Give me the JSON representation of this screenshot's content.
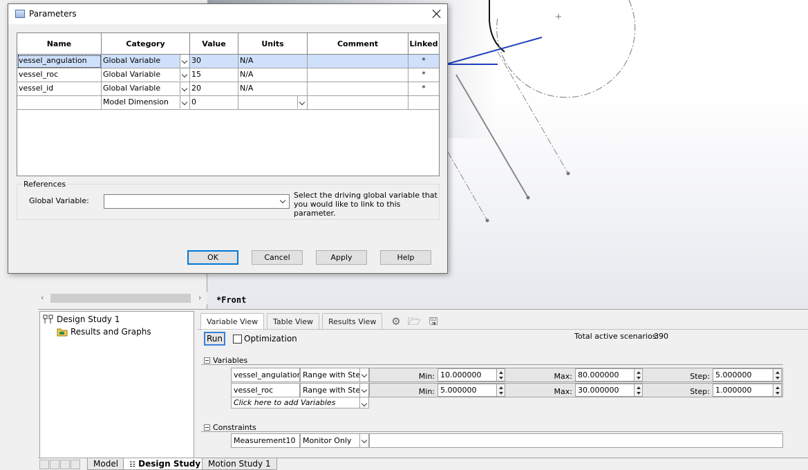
{
  "dialog": {
    "title": "Parameters",
    "columns": [
      "Name",
      "Category",
      "Value",
      "Units",
      "Comment",
      "Linked"
    ],
    "rows": [
      {
        "name": "vessel_angulation",
        "category": "Global Variable",
        "value": "30",
        "units": "N/A",
        "comment": "",
        "linked": "*"
      },
      {
        "name": "vessel_roc",
        "category": "Global Variable",
        "value": "15",
        "units": "N/A",
        "comment": "",
        "linked": "*"
      },
      {
        "name": "vessel_id",
        "category": "Global Variable",
        "value": "20",
        "units": "N/A",
        "comment": "",
        "linked": "*"
      },
      {
        "name": "",
        "category": "Model Dimension",
        "value": "0",
        "units": "",
        "comment": "",
        "linked": ""
      }
    ],
    "references": {
      "group_label": "References",
      "global_variable_label": "Global Variable:",
      "global_variable_value": "",
      "help_text": "Select the driving global variable that you would like to link to this parameter."
    },
    "buttons": {
      "ok": "OK",
      "cancel": "Cancel",
      "apply": "Apply",
      "help": "Help"
    }
  },
  "viewport": {
    "view_label": "*Front"
  },
  "study": {
    "tree": {
      "root": "Design Study 1",
      "child": "Results and Graphs"
    },
    "tabs": [
      "Variable View",
      "Table View",
      "Results View"
    ],
    "run_label": "Run",
    "optimization_label": "Optimization",
    "total_scenarios_label": "Total active scenarios:",
    "total_scenarios_value": "390",
    "variables_label": "Variables",
    "variables": [
      {
        "name": "vessel_angulation",
        "type": "Range with Step",
        "min_label": "Min:",
        "min": "10.000000",
        "max_label": "Max:",
        "max": "80.000000",
        "step_label": "Step:",
        "step": "5.000000"
      },
      {
        "name": "vessel_roc",
        "type": "Range with Step",
        "min_label": "Min:",
        "min": "5.000000",
        "max_label": "Max:",
        "max": "30.000000",
        "step_label": "Step:",
        "step": "1.000000"
      }
    ],
    "add_variables": "Click here to add Variables",
    "constraints_label": "Constraints",
    "constraints": [
      {
        "name": "Measurement10",
        "type": "Monitor Only"
      }
    ]
  },
  "sheet_tabs": [
    "Model",
    "Design Study 1",
    "Motion Study 1"
  ],
  "colors": {
    "accent": "#0078d7",
    "selection": "#cfe0fb",
    "sketch_blue": "#1f3fbf"
  }
}
